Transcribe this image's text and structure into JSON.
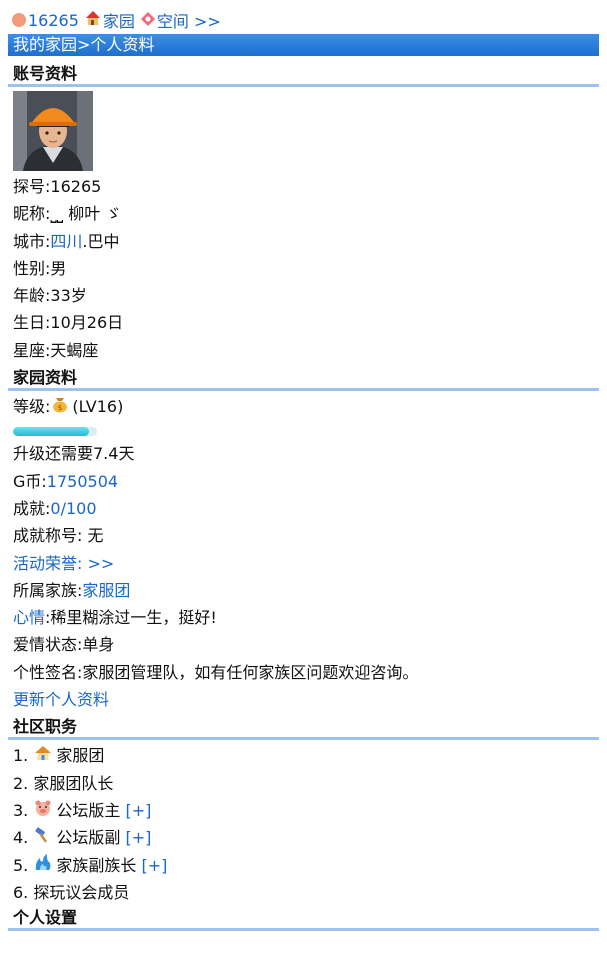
{
  "topbar": {
    "user_id": "16265",
    "home_label": "家园",
    "space_label": "空间 >>"
  },
  "title": "我的家园>个人资料",
  "account": {
    "heading": "账号资料",
    "id_label": "探号:",
    "id_value": "16265",
    "nickname_label": "昵称:",
    "nickname_value": "⎵⎵ 柳叶 ゞ",
    "city_label": "城市:",
    "city_province": "四川",
    "city_rest": ".巴中",
    "gender_label": "性别:",
    "gender_value": "男",
    "age_label": "年龄:",
    "age_value": "33岁",
    "birthday_label": "生日:",
    "birthday_value": "10月26日",
    "zodiac_label": "星座:",
    "zodiac_value": "天蝎座"
  },
  "home": {
    "heading": "家园资料",
    "level_label": "等级:",
    "level_value": "(LV16)",
    "upgrade_text": "升级还需要7.4天",
    "gcoin_label": "G币:",
    "gcoin_value": "1750504",
    "achievement_label": "成就:",
    "achievement_value": "0/100",
    "achievement_title_label": "成就称号:",
    "achievement_title_value": " 无",
    "honor_link": "活动荣誉: >>",
    "family_label": "所属家族:",
    "family_value": "家服团",
    "mood_label": "心情",
    "mood_value": ":稀里糊涂过一生，挺好!",
    "love_label": "爱情状态:",
    "love_value": "单身",
    "signature_label": "个性签名:",
    "signature_value": "家服团管理队，如有任何家族区问题欢迎咨询。",
    "update_link": "更新个人资料"
  },
  "level_progress": 0.9,
  "roles": {
    "heading": "社区职务",
    "items": [
      {
        "num": "1.",
        "icon": "house-icon",
        "label": "家服团",
        "plus": ""
      },
      {
        "num": "2.",
        "icon": "",
        "label": "家服团队长",
        "plus": ""
      },
      {
        "num": "3.",
        "icon": "pig-icon",
        "label": "公坛版主",
        "plus": "[+]"
      },
      {
        "num": "4.",
        "icon": "hammer-icon",
        "label": "公坛版副",
        "plus": "[+]"
      },
      {
        "num": "5.",
        "icon": "flame-icon",
        "label": "家族副族长",
        "plus": "[+]"
      },
      {
        "num": "6.",
        "icon": "",
        "label": "探玩议会成员",
        "plus": ""
      }
    ]
  },
  "settings": {
    "heading": "个人设置"
  }
}
